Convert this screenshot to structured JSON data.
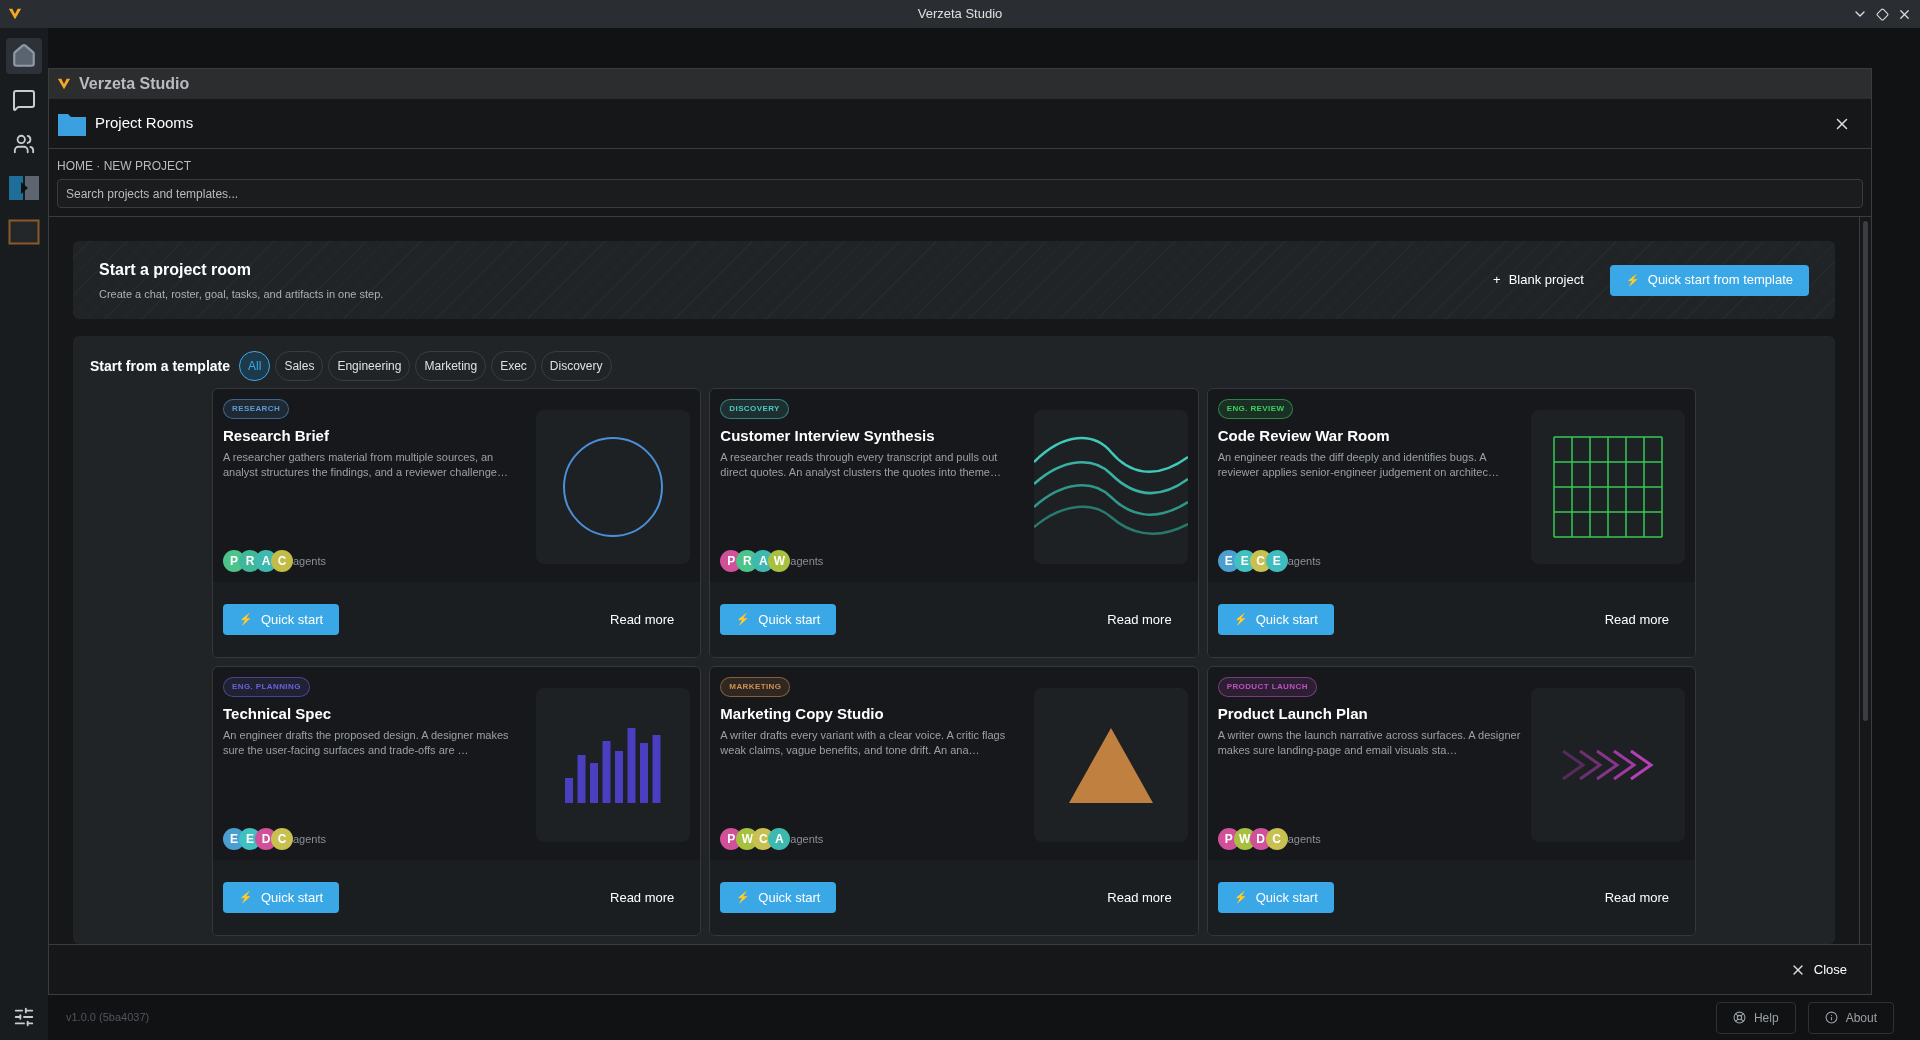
{
  "window": {
    "title": "Verzeta Studio"
  },
  "sidebar": {
    "items": [
      {
        "kind": "home",
        "selected": true
      },
      {
        "kind": "chat",
        "selected": false
      },
      {
        "kind": "people",
        "selected": false
      },
      {
        "kind": "split",
        "selected": false
      },
      {
        "kind": "board",
        "selected": false
      }
    ]
  },
  "modal": {
    "app_title": "Verzeta Studio",
    "title": "Project Rooms",
    "breadcrumb": "HOME · NEW PROJECT",
    "search": {
      "placeholder": "Search projects and templates..."
    },
    "hero": {
      "title": "Start a project room",
      "subtitle": "Create a chat, roster, goal, tasks, and artifacts in one step.",
      "blank_button": "Blank project",
      "blank_icon": "+",
      "quick_button": "Quick start from template",
      "quick_icon": "⚡"
    },
    "templates": {
      "label": "Start from a template",
      "filters": [
        {
          "label": "All",
          "selected": true
        },
        {
          "label": "Sales",
          "selected": false
        },
        {
          "label": "Engineering",
          "selected": false
        },
        {
          "label": "Marketing",
          "selected": false
        },
        {
          "label": "Exec",
          "selected": false
        },
        {
          "label": "Discovery",
          "selected": false
        }
      ],
      "cards": [
        {
          "tag": "RESEARCH",
          "color": "#5b9bd5",
          "title": "Research Brief",
          "description": "A researcher gathers material from multiple sources, an analyst structures the findings, and a reviewer challenge…",
          "kind": "circle",
          "avatars": [
            {
              "letter": "P",
              "color": "#4cc38a"
            },
            {
              "letter": "R",
              "color": "#3fb89a"
            },
            {
              "letter": "A",
              "color": "#3fb9b0"
            },
            {
              "letter": "C",
              "color": "#c2bc48"
            }
          ],
          "agents": "agents",
          "quick": "Quick start",
          "more": "Read more"
        },
        {
          "tag": "DISCOVERY",
          "color": "#4cc7c0",
          "title": "Customer Interview Synthesis",
          "description": "A researcher reads through every transcript and pulls out direct quotes. An analyst clusters the quotes into theme…",
          "kind": "waves",
          "avatars": [
            {
              "letter": "P",
              "color": "#d0509a"
            },
            {
              "letter": "R",
              "color": "#4cc38a"
            },
            {
              "letter": "A",
              "color": "#3fb9b0"
            },
            {
              "letter": "W",
              "color": "#a8c040"
            }
          ],
          "agents": "agents",
          "quick": "Quick start",
          "more": "Read more"
        },
        {
          "tag": "ENG. REVIEW",
          "color": "#3ecf5e",
          "title": "Code Review War Room",
          "description": "An engineer reads the diff deeply and identifies bugs. A reviewer applies senior-engineer judgement on architec…",
          "kind": "grid",
          "avatars": [
            {
              "letter": "E",
              "color": "#4a9fd0"
            },
            {
              "letter": "E",
              "color": "#40c0c0"
            },
            {
              "letter": "C",
              "color": "#c8c050"
            },
            {
              "letter": "E",
              "color": "#3fbcc0"
            }
          ],
          "agents": "agents",
          "quick": "Quick start",
          "more": "Read more"
        },
        {
          "tag": "ENG. PLANNING",
          "color": "#6a63d8",
          "title": "Technical Spec",
          "description": "An engineer drafts the proposed design. A designer makes sure the user-facing surfaces and trade-offs are …",
          "kind": "bars",
          "avatars": [
            {
              "letter": "E",
              "color": "#4a9fd0"
            },
            {
              "letter": "E",
              "color": "#40c0c0"
            },
            {
              "letter": "D",
              "color": "#d0509a"
            },
            {
              "letter": "C",
              "color": "#c8c050"
            }
          ],
          "agents": "agents",
          "quick": "Quick start",
          "more": "Read more"
        },
        {
          "tag": "MARKETING",
          "color": "#d09050",
          "title": "Marketing Copy Studio",
          "description": "A writer drafts every variant with a clear voice. A critic flags weak claims, vague benefits, and tone drift. An ana…",
          "kind": "triangle",
          "avatars": [
            {
              "letter": "P",
              "color": "#d0509a"
            },
            {
              "letter": "W",
              "color": "#a8c040"
            },
            {
              "letter": "C",
              "color": "#c8c050"
            },
            {
              "letter": "A",
              "color": "#3fb9b0"
            }
          ],
          "agents": "agents",
          "quick": "Quick start",
          "more": "Read more"
        },
        {
          "tag": "PRODUCT LAUNCH",
          "color": "#c050c8",
          "title": "Product Launch Plan",
          "description": "A writer owns the launch narrative across surfaces. A designer makes sure landing-page and email visuals sta…",
          "kind": "chevrons",
          "avatars": [
            {
              "letter": "P",
              "color": "#d0509a"
            },
            {
              "letter": "W",
              "color": "#a8c040"
            },
            {
              "letter": "D",
              "color": "#d0509a"
            },
            {
              "letter": "C",
              "color": "#c8c050"
            }
          ],
          "agents": "agents",
          "quick": "Quick start",
          "more": "Read more"
        }
      ]
    },
    "close_button": "Close"
  },
  "status_bar": {
    "version": "v1.0.0 (5ba4037)",
    "help": "Help",
    "about": "About"
  }
}
